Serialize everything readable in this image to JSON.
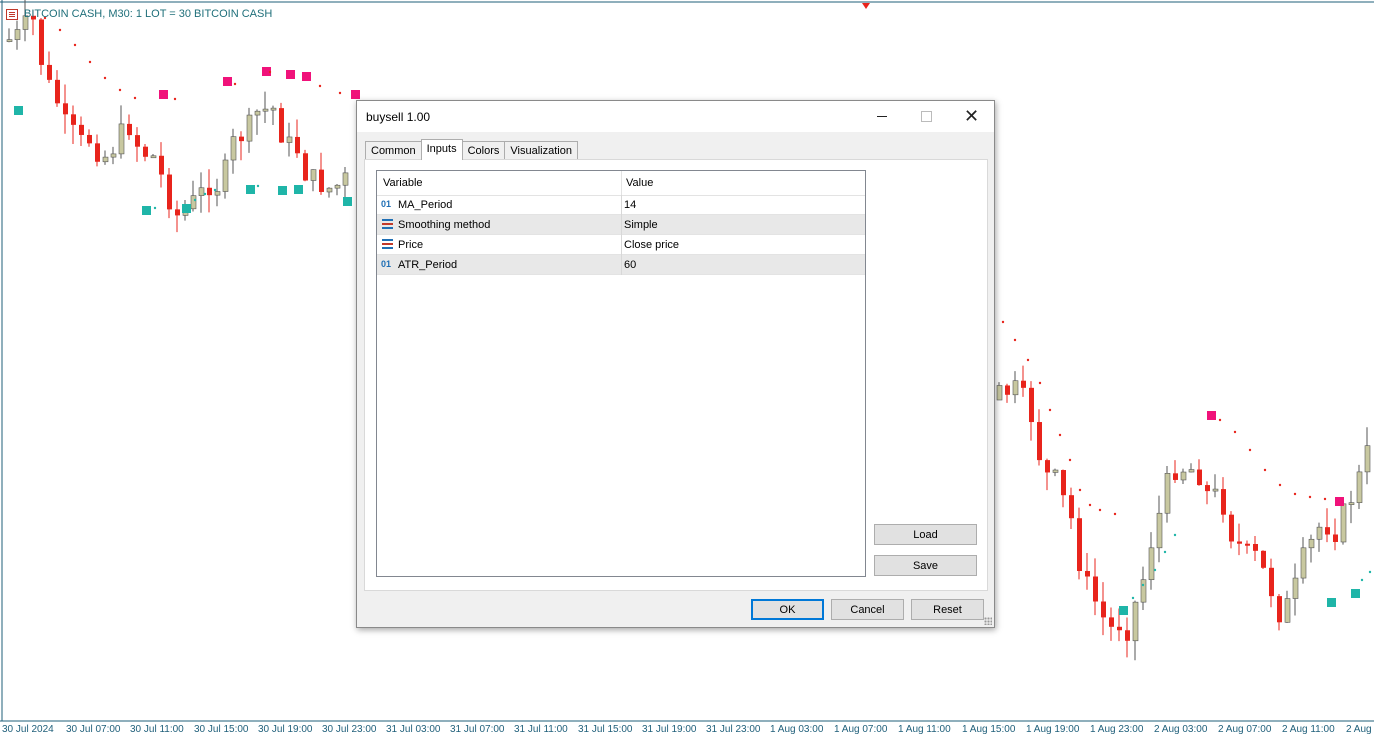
{
  "chart": {
    "header_text": "BITCOIN CASH, M30:  1 LOT = 30 BITCOIN CASH",
    "time_labels": [
      "30 Jul 2024",
      "30 Jul 07:00",
      "30 Jul 11:00",
      "30 Jul 15:00",
      "30 Jul 19:00",
      "30 Jul 23:00",
      "31 Jul 03:00",
      "31 Jul 07:00",
      "31 Jul 11:00",
      "31 Jul 15:00",
      "31 Jul 19:00",
      "31 Jul 23:00",
      "1 Aug 03:00",
      "1 Aug 07:00",
      "1 Aug 11:00",
      "1 Aug 15:00",
      "1 Aug 19:00",
      "1 Aug 23:00",
      "2 Aug 03:00",
      "2 Aug 07:00",
      "2 Aug 11:00",
      "2 Aug"
    ],
    "colors": {
      "bull_body": "#c8c8a0",
      "bear": "#e8241c",
      "sell_marker": "#f0127a",
      "buy_marker": "#1fb5a8",
      "axis_text": "#1f5f7a"
    }
  },
  "dialog": {
    "title": "buysell 1.00",
    "tabs": [
      "Common",
      "Inputs",
      "Colors",
      "Visualization"
    ],
    "active_tab": "Inputs",
    "columns": {
      "variable": "Variable",
      "value": "Value"
    },
    "rows": [
      {
        "icon": "int-icon",
        "icon_text": "01",
        "variable": "MA_Period",
        "value": "14"
      },
      {
        "icon": "enum-icon",
        "icon_text": "",
        "variable": "Smoothing method",
        "value": "Simple"
      },
      {
        "icon": "enum-icon",
        "icon_text": "",
        "variable": "Price",
        "value": "Close price"
      },
      {
        "icon": "int-icon",
        "icon_text": "01",
        "variable": "ATR_Period",
        "value": "60"
      }
    ],
    "buttons": {
      "load": "Load",
      "save": "Save",
      "ok": "OK",
      "cancel": "Cancel",
      "reset": "Reset"
    }
  }
}
